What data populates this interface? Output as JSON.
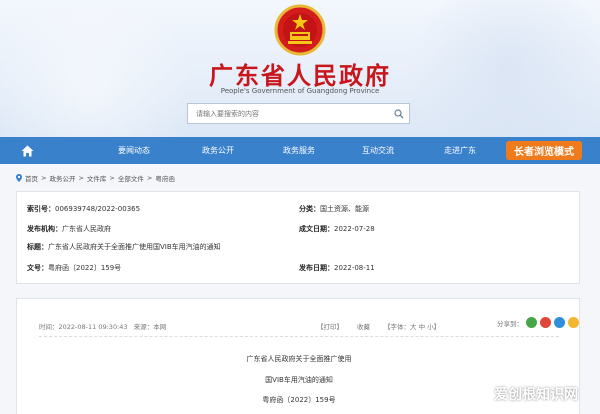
{
  "header": {
    "title": "广东省人民政府",
    "subtitle": "People's Government of Guangdong Province",
    "search_placeholder": "请输入要搜索的内容"
  },
  "nav": {
    "items": [
      "要闻动态",
      "政务公开",
      "政务服务",
      "互动交流",
      "走进广东"
    ],
    "elder_mode": "长者浏览模式"
  },
  "breadcrumb": [
    "首页",
    "政务公开",
    "文件库",
    "全部文件",
    "粤府函"
  ],
  "info": {
    "index_label": "索引号：",
    "index_value": "006939748/2022-00365",
    "category_label": "分类：",
    "category_value": "国土资源、能源",
    "issuer_label": "发布机构：",
    "issuer_value": "广东省人民政府",
    "created_label": "成文日期：",
    "created_value": "2022-07-28",
    "title_label": "标题：",
    "title_value": "广东省人民政府关于全面推广使用国VIB车用汽油的通知",
    "docno_label": "文号：",
    "docno_value": "粤府函〔2022〕159号",
    "published_label": "发布日期：",
    "published_value": "2022-08-11"
  },
  "article": {
    "time": "时间：2022-08-11 09:30:43",
    "source": "来源：本网",
    "print": "【打印】",
    "favorite": "收藏",
    "font_size": "【字体：大  中  小】",
    "share": "分享到：",
    "title_line1": "广东省人民政府关于全面推广使用",
    "title_line2": "国VIB车用汽油的通知",
    "doc_number": "粤府函〔2022〕159号"
  },
  "watermark": "爱创根知识网",
  "colors": {
    "brand_red": "#c8161d",
    "nav_blue": "#3a81cc",
    "elder_orange": "#f07b1c"
  }
}
